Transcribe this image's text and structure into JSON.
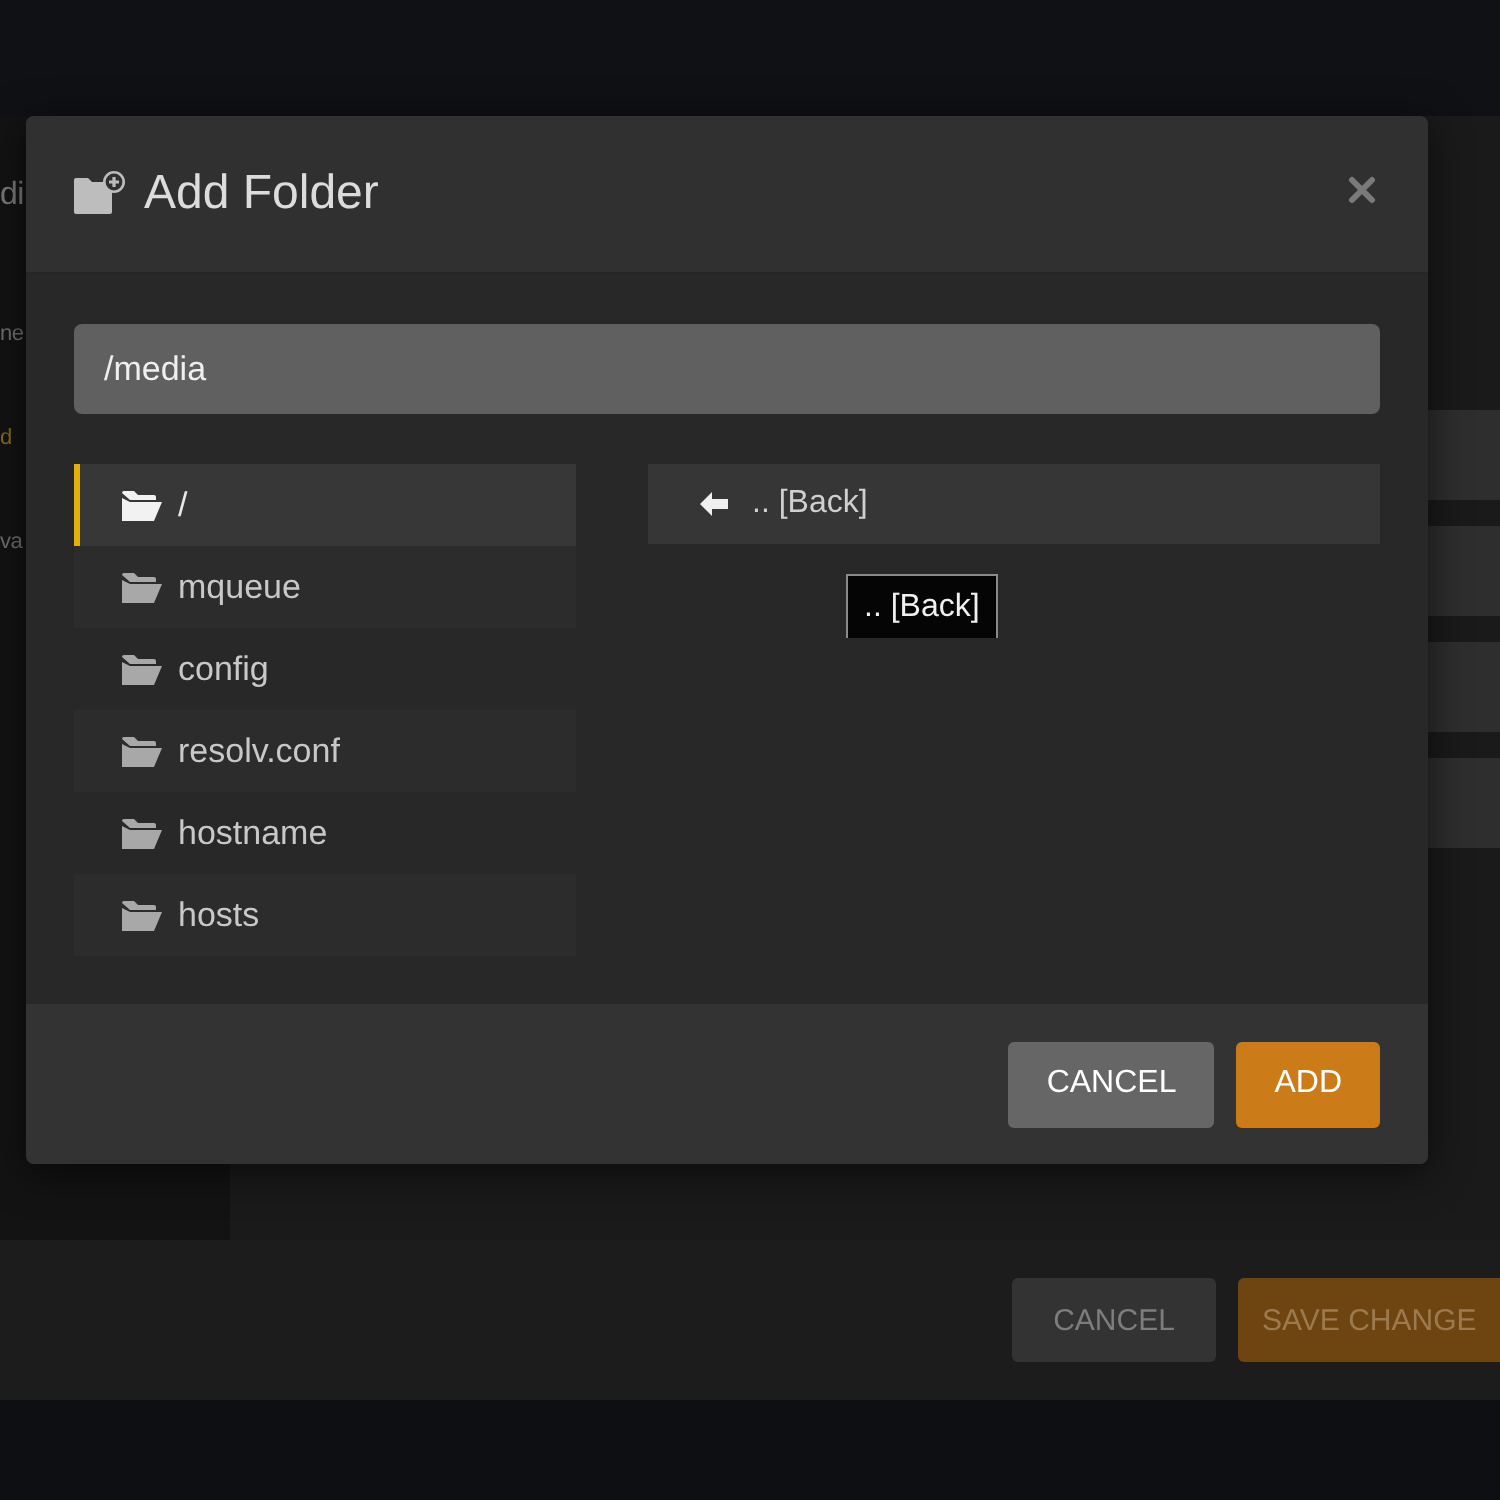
{
  "background_page": {
    "sidebar_fragments": [
      {
        "text": "di",
        "kind": "heading"
      },
      {
        "text": "ne",
        "kind": "text"
      },
      {
        "text": "d",
        "kind": "accent"
      },
      {
        "text": "va",
        "kind": "text"
      }
    ],
    "fields": [
      {
        "kind": "field"
      },
      {
        "kind": "field"
      },
      {
        "kind": "field"
      },
      {
        "kind": "field"
      }
    ],
    "buttons": [
      {
        "label": "CANCEL",
        "kind": "secondary"
      },
      {
        "label": "SAVE CHANGE",
        "kind": "primary"
      }
    ]
  },
  "dialog": {
    "title": "Add Folder",
    "path": {
      "value": "/media"
    },
    "folders": [
      {
        "name": "/",
        "selected": true
      },
      {
        "name": "mqueue",
        "selected": false
      },
      {
        "name": "config",
        "selected": false
      },
      {
        "name": "resolv.conf",
        "selected": false
      },
      {
        "name": "hostname",
        "selected": false
      },
      {
        "name": "hosts",
        "selected": false
      }
    ],
    "back_item": {
      "label": ".. [Back]"
    },
    "tooltip": {
      "text": ".. [Back]"
    },
    "buttons": [
      {
        "label": "CANCEL",
        "kind": "secondary"
      },
      {
        "label": "ADD",
        "kind": "primary"
      }
    ]
  }
}
